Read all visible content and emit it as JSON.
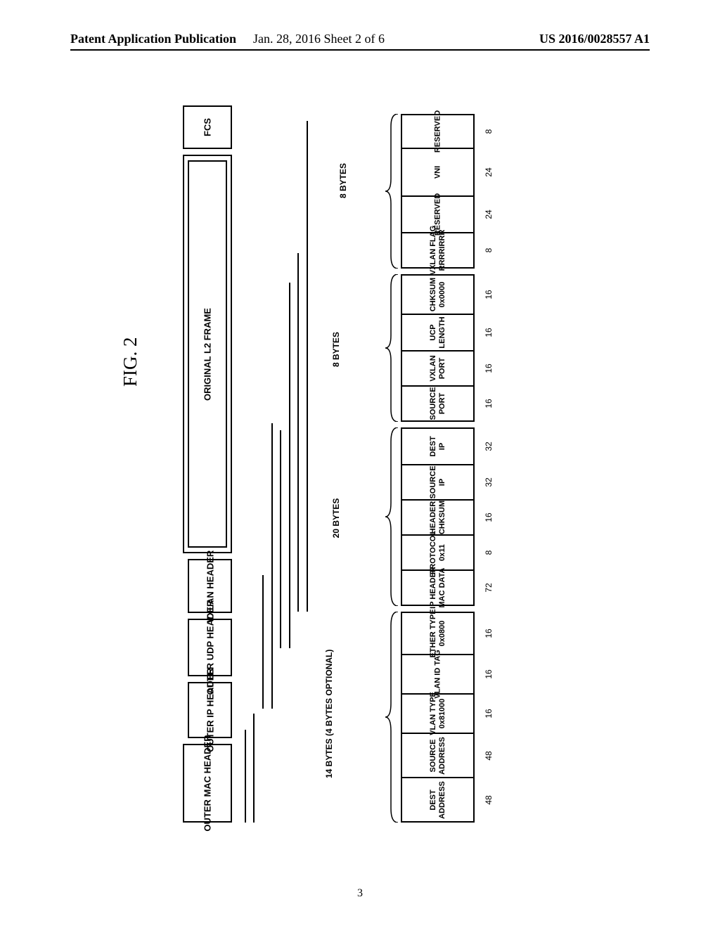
{
  "header": {
    "left": "Patent Application Publication",
    "center": "Jan. 28, 2016  Sheet 2 of 6",
    "right": "US 2016/0028557 A1"
  },
  "figure_label": "FIG. 2",
  "top_segments": [
    {
      "label": "OUTER\nMAC\nHEADER"
    },
    {
      "label": "OUTER IP\nHEADER"
    },
    {
      "label": "OUTER UDP\nHEADER"
    },
    {
      "label": "VXLAN\nHEADER"
    },
    {
      "label": "ORIGINAL L2 FRAME"
    },
    {
      "label": "FCS"
    }
  ],
  "group_sizes": [
    {
      "label": "14 BYTES\n(4 BYTES OPTIONAL)"
    },
    {
      "label": "20 BYTES"
    },
    {
      "label": "8 BYTES"
    },
    {
      "label": "8 BYTES"
    }
  ],
  "outer_mac": {
    "fields": [
      {
        "name": "DEST\nADDRESS",
        "bits": "48"
      },
      {
        "name": "SOURCE\nADDRESS",
        "bits": "48"
      },
      {
        "name": "VLAN TYPE\n0x81000",
        "bits": "16"
      },
      {
        "name": "VLAN ID TAG",
        "bits": "16"
      },
      {
        "name": "ETHER TYPE\n0x0800",
        "bits": "16"
      }
    ]
  },
  "outer_ip": {
    "fields": [
      {
        "name": "IP HEADER\nMAC DATA",
        "bits": "72"
      },
      {
        "name": "PROTOCOL\n0x11",
        "bits": "8"
      },
      {
        "name": "HEADER\nCHKSUM",
        "bits": "16"
      },
      {
        "name": "SOURCE\nIP",
        "bits": "32"
      },
      {
        "name": "DEST\nIP",
        "bits": "32"
      }
    ]
  },
  "outer_udp": {
    "fields": [
      {
        "name": "SOURCE\nPORT",
        "bits": "16"
      },
      {
        "name": "VXLAN\nPORT",
        "bits": "16"
      },
      {
        "name": "UCP\nLENGTH",
        "bits": "16"
      },
      {
        "name": "CHKSUM\n0x0000",
        "bits": "16"
      }
    ]
  },
  "vxlan": {
    "fields": [
      {
        "name": "VXLAN FLAG\nRRRRIRRR",
        "bits": "8"
      },
      {
        "name": "RESERVED",
        "bits": "24"
      },
      {
        "name": "VNI",
        "bits": "24"
      },
      {
        "name": "RESERVED",
        "bits": "8"
      }
    ]
  },
  "page_number": "3"
}
